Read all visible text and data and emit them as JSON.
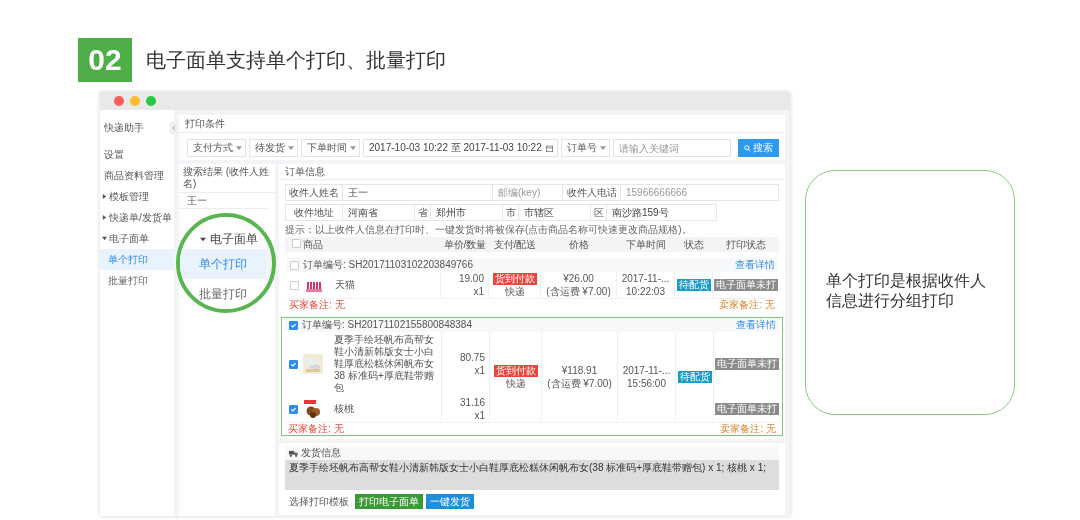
{
  "heading": {
    "badge": "02",
    "title": "电子面单支持单个打印、批量打印"
  },
  "sidebar": {
    "title": "快递助手",
    "items": [
      {
        "label": "设置",
        "kind": "link"
      },
      {
        "label": "商品资料管理",
        "kind": "link"
      },
      {
        "label": "模板管理",
        "kind": "group",
        "expanded": false
      },
      {
        "label": "快递单/发货单",
        "kind": "group",
        "expanded": false
      },
      {
        "label": "电子面单",
        "kind": "group",
        "expanded": true,
        "children": [
          {
            "label": "单个打印",
            "selected": true
          },
          {
            "label": "批量打印",
            "selected": false
          }
        ]
      }
    ]
  },
  "filters": {
    "title": "打印条件",
    "selects": [
      "支付方式",
      "待发货",
      "下单时间"
    ],
    "date_range": "2017-10-03 10:22 至 2017-11-03 10:22",
    "order_select": "订单号",
    "search_placeholder": "请输入关键词",
    "search_button": "搜索"
  },
  "results": {
    "title": "搜索结果 (收件人姓名)",
    "items": [
      "王一"
    ]
  },
  "magnifier": {
    "group": "电子面单",
    "items": [
      {
        "label": "单个打印",
        "selected": true
      },
      {
        "label": "批量打印",
        "selected": false
      }
    ]
  },
  "order_info": {
    "title": "订单信息",
    "name_label": "收件人姓名",
    "name": "王一",
    "zip_placeholder": "邮编(key)",
    "phone_label": "收件人电话",
    "phone": "15966666666",
    "address_label": "收件地址",
    "address": [
      {
        "value": "河南省",
        "unit": "省"
      },
      {
        "value": "郑州市",
        "unit": "市"
      },
      {
        "value": "市辖区",
        "unit": "区"
      },
      {
        "value": "南沙路159号"
      }
    ],
    "hint": "提示：以上收件人信息在打印时、一键发货时将被保存(点击商品名称可快速更改商品规格)。"
  },
  "table": {
    "select_all_checked": false,
    "columns": [
      "商品",
      "单价/数量",
      "支付/配送",
      "价格",
      "下单时间",
      "状态",
      "打印状态"
    ]
  },
  "orders": [
    {
      "number": "订单编号: SH20171103102203849766",
      "selected": false,
      "highlighted": false,
      "detail_link": "查看详情",
      "payment_tag": "货到付款",
      "shipping": "快递",
      "total": "¥26.00",
      "fee": "(含运费 ¥7.00)",
      "date": "2017-11-...",
      "time": "10:22:03",
      "status": "待配货",
      "buyer_note": "买家备注: 无",
      "seller_note": "卖家备注: 无",
      "items": [
        {
          "name": "天猫",
          "selected": false,
          "unit_price": "19.00",
          "quantity": "x1",
          "print_status": "电子面单未打"
        }
      ]
    },
    {
      "number": "订单编号: SH20171102155800848384",
      "selected": true,
      "highlighted": true,
      "detail_link": "查看详情",
      "payment_tag": "货到付款",
      "shipping": "快递",
      "total": "¥118.91",
      "fee": "(含运费 ¥7.00)",
      "date": "2017-11-...",
      "time": "15:56:00",
      "status": "待配货",
      "buyer_note": "买家备注: 无",
      "seller_note": "卖家备注: 无",
      "items": [
        {
          "name": "夏季手绘坯帆布高帮女鞋小清新韩版女士小白鞋厚底松糕休闲帆布女 38 标准码+厚底鞋带赠包",
          "selected": true,
          "unit_price": "80.75",
          "quantity": "x1",
          "print_status": "电子面单未打"
        },
        {
          "name": "核桃",
          "selected": true,
          "unit_price": "31.16",
          "quantity": "x1",
          "print_status": "电子面单未打"
        }
      ]
    }
  ],
  "shipping": {
    "title": "发货信息",
    "content": "夏季手绘坯帆布高帮女鞋小清新韩版女士小白鞋厚底松糕休闲帆布女(38 标准码+厚底鞋带赠包) x 1; 核桃 x 1;",
    "template_label": "选择打印模板",
    "buttons": [
      {
        "label": "打印电子面单",
        "kind": "print"
      },
      {
        "label": "一键发货",
        "kind": "ship"
      }
    ]
  },
  "note": {
    "text": "单个打印是根据收件人信息进行分组打印"
  }
}
